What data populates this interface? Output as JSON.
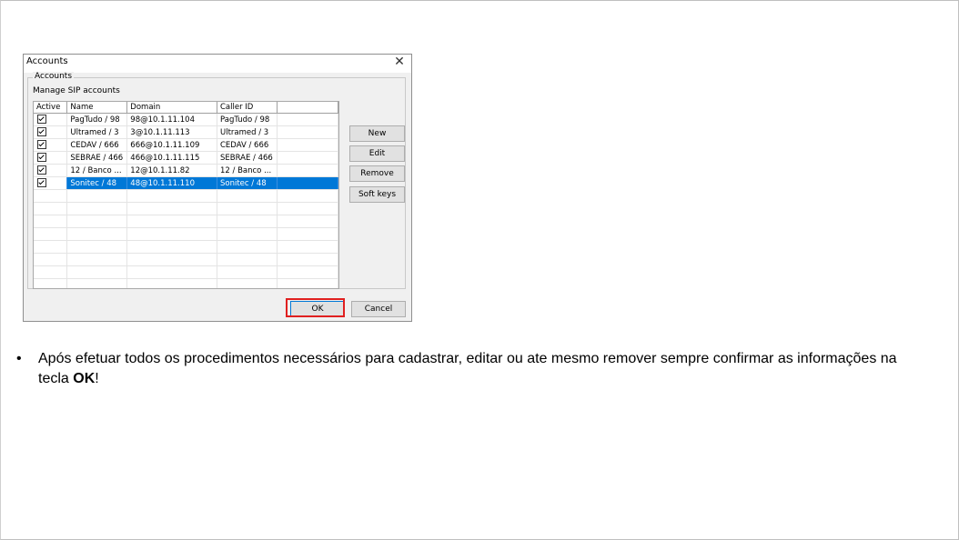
{
  "dialog": {
    "title": "Accounts",
    "group_label": "Accounts",
    "manage_label": "Manage SIP accounts",
    "columns": [
      "Active",
      "Name",
      "Domain",
      "Caller ID"
    ],
    "rows": [
      {
        "active": true,
        "name": "PagTudo / 98",
        "domain": "98@10.1.11.104",
        "caller_id": "PagTudo / 98",
        "selected": false
      },
      {
        "active": true,
        "name": "Ultramed / 3",
        "domain": "3@10.1.11.113",
        "caller_id": "Ultramed / 3",
        "selected": false
      },
      {
        "active": true,
        "name": "CEDAV / 666",
        "domain": "666@10.1.11.109",
        "caller_id": "CEDAV / 666",
        "selected": false
      },
      {
        "active": true,
        "name": "SEBRAE / 466",
        "domain": "466@10.1.11.115",
        "caller_id": "SEBRAE / 466",
        "selected": false
      },
      {
        "active": true,
        "name": "12 / Banco ...",
        "domain": "12@10.1.11.82",
        "caller_id": "12 / Banco ...",
        "selected": false
      },
      {
        "active": true,
        "name": "Sonitec / 48",
        "domain": "48@10.1.11.110",
        "caller_id": "Sonitec / 48",
        "selected": true
      }
    ],
    "buttons": {
      "new": "New",
      "edit": "Edit",
      "remove": "Remove",
      "soft_keys": "Soft keys",
      "ok": "OK",
      "cancel": "Cancel"
    },
    "close_icon": "close-icon",
    "colors": {
      "selection": "#0078d7",
      "highlight": "#e02020"
    }
  },
  "bullet": {
    "text_before": "Após efetuar todos os procedimentos necessários para cadastrar, editar ou ate mesmo remover sempre confirmar as informações na tecla ",
    "bold": "OK",
    "text_after": "!"
  }
}
